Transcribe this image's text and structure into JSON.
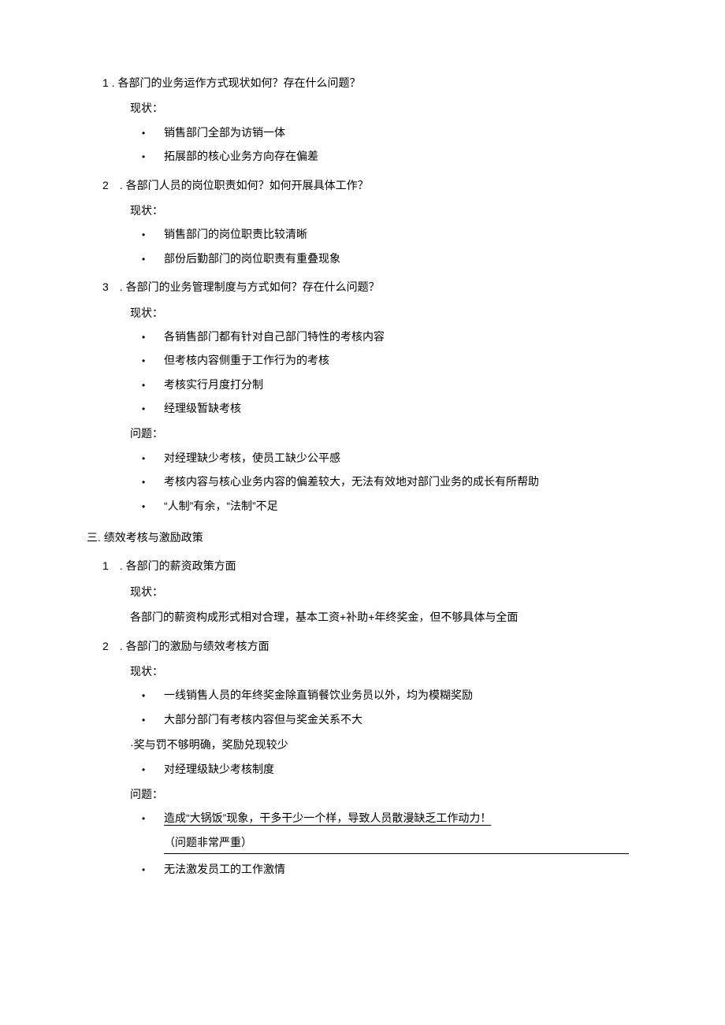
{
  "q1": {
    "title": "1 . 各部门的业务运作方式现状如何？存在什么问题？",
    "status_label": "现状：",
    "bullets": [
      "销售部门全部为访销一体",
      "拓展部的核心业务方向存在偏差"
    ]
  },
  "q2": {
    "title": "2　. 各部门人员的岗位职责如何？如何开展具体工作？",
    "status_label": "现状：",
    "bullets": [
      "销售部门的岗位职责比较清晰",
      "部份后勤部门的岗位职责有重叠现象"
    ]
  },
  "q3": {
    "title": "3　. 各部门的业务管理制度与方式如何？存在什么问题？",
    "status_label": "现状：",
    "status_bullets": [
      "各销售部门都有针对自己部门特性的考核内容",
      "但考核内容侧重于工作行为的考核",
      "考核实行月度打分制",
      "经理级暂缺考核"
    ],
    "problem_label": "问题：",
    "problem_bullets": [
      "对经理缺少考核，使员工缺少公平感",
      "考核内容与核心业务内容的偏差较大，无法有效地对部门业务的成长有所帮助",
      "“人制”有余，“法制”不足"
    ]
  },
  "section3": {
    "heading": "三. 绩效考核与激励政策",
    "s1": {
      "title": "1　. 各部门的薪资政策方面",
      "status_label": "现状：",
      "status_text": "各部门的薪资构成形式相对合理，基本工资+补助+年终奖金，但不够具体与全面"
    },
    "s2": {
      "title": "2　. 各部门的激励与绩效考核方面",
      "status_label": "现状：",
      "status_bullets_a": [
        "一线销售人员的年终奖金除直销餐饮业务员以外，均为模糊奖励",
        "大部分部门有考核内容但与奖金关系不大"
      ],
      "status_dot_line": "·奖与罚不够明确，奖励兑现较少",
      "status_bullets_b": [
        "对经理级缺少考核制度"
      ],
      "problem_label": "问题：",
      "problem_underline": "造成“大锅饭”现象，干多干少一个样，导致人员散漫缺乏工作动力！",
      "problem_note": "（问题非常严重）",
      "problem_bullets_rest": [
        "无法激发员工的工作激情"
      ]
    }
  },
  "bullet_char": "•"
}
